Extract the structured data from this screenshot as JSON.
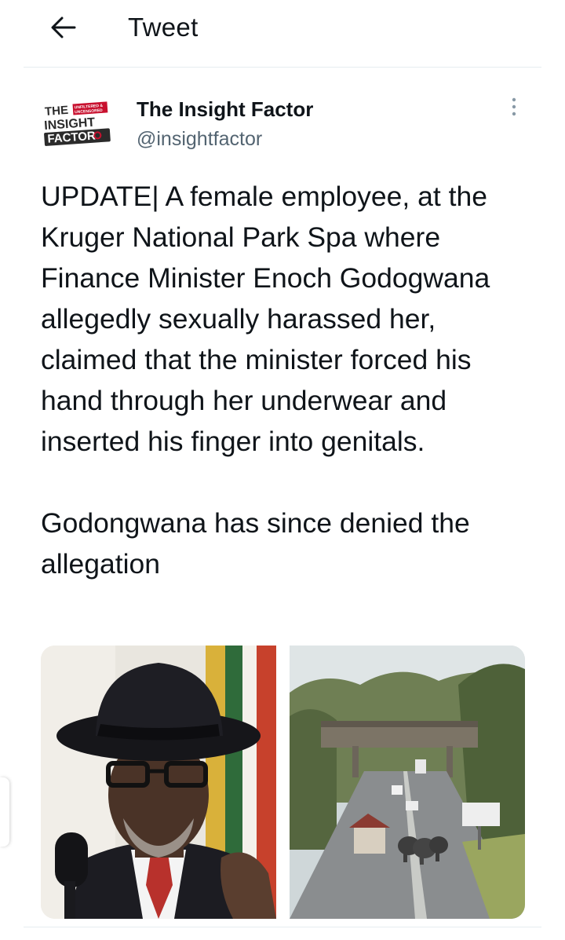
{
  "header": {
    "back_icon": "arrow-left-icon",
    "title": "Tweet"
  },
  "tweet": {
    "author": {
      "avatar_logo_lines": [
        "THE",
        "INSIGHT",
        "FACTOR",
        "UNFILTERED &",
        "UNCENSORED"
      ],
      "display_name": "The Insight Factor",
      "handle": "@insightfactor"
    },
    "more_icon": "more-vertical-icon",
    "text_paragraphs": [
      "UPDATE| A female employee, at the Kruger National Park Spa where Finance Minister Enoch Godogwana allegedly sexually harassed her, claimed that the minister forced his hand through her underwear and inserted his finger into genitals.",
      "Godongwana has since denied the allegation"
    ],
    "media": [
      {
        "name": "photo-man-in-hat"
      },
      {
        "name": "photo-park-gate-elephants"
      }
    ]
  },
  "colors": {
    "text_primary": "#0f1419",
    "text_secondary": "#536471",
    "divider": "#e6ecf0",
    "logo_red": "#c8102e",
    "logo_dark": "#2b2b2b"
  }
}
